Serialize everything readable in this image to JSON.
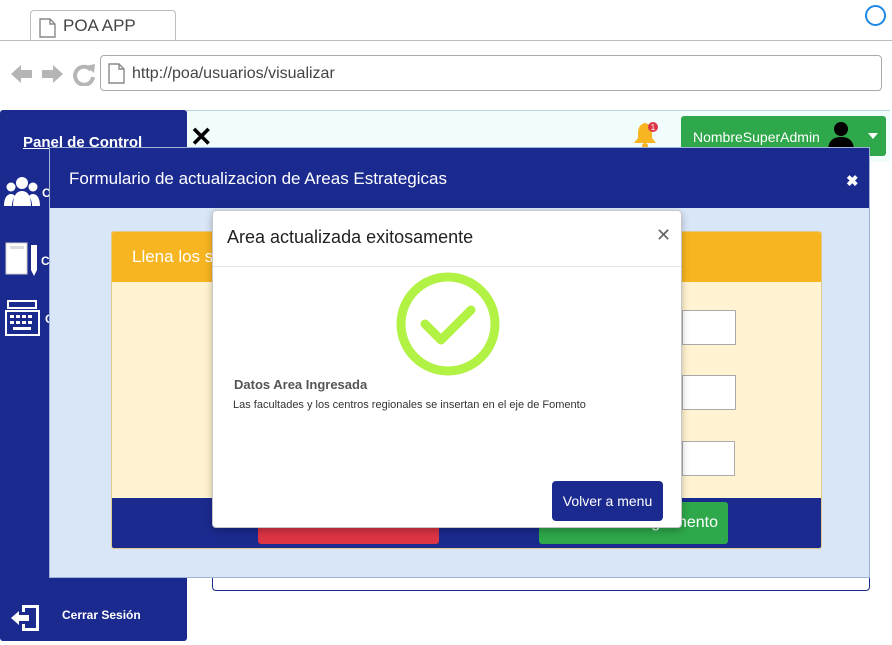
{
  "browser": {
    "tab_title": "POA APP",
    "url": "http://poa/usuarios/visualizar"
  },
  "header": {
    "user_name": "NombreSuperAdmin",
    "notification_count": "1"
  },
  "sidebar": {
    "title": "Panel de Control",
    "items": [
      {
        "label": "C",
        "icon": "users-icon"
      },
      {
        "label": "C",
        "icon": "book-icon"
      },
      {
        "label": "C",
        "icon": "keyboard-icon"
      }
    ],
    "logout_label": "Cerrar Sesión"
  },
  "modal": {
    "title": "Formulario de actualizacion de Areas Estrategicas",
    "form_header": "Llena los s",
    "submit_label": "g                 amento"
  },
  "dialog": {
    "title": "Area actualizada exitosamente",
    "heading": "Datos Area Ingresada",
    "message": "Las facultades y los centros regionales se insertan en el eje de Fomento",
    "button_label": "Volver a menu"
  },
  "colors": {
    "primary": "#1b2a8f",
    "success": "#2ea84a",
    "warning": "#f7b521",
    "danger": "#dc3545",
    "check": "#b2f244"
  }
}
